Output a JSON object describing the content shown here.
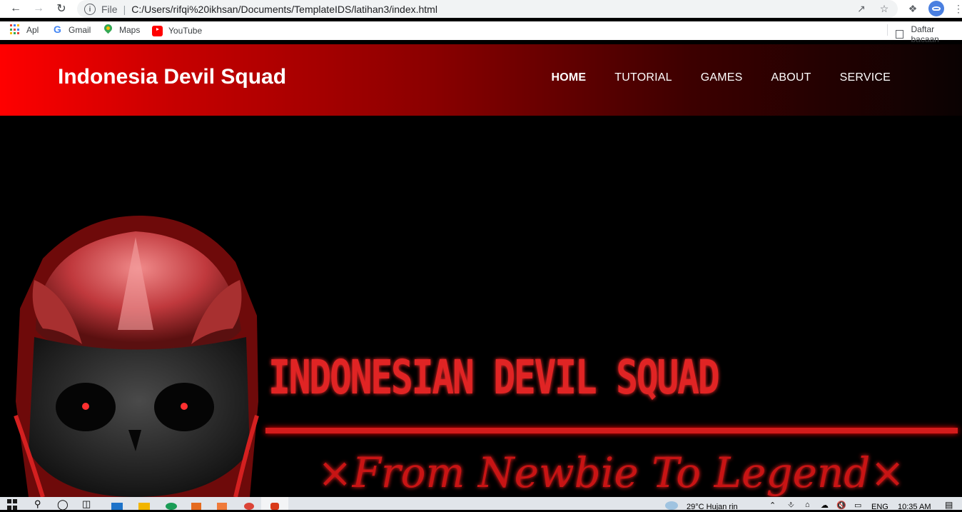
{
  "browser": {
    "scheme": "File",
    "url": "C:/Users/rifqi%20ikhsan/Documents/TemplateIDS/latihan3/index.html",
    "bookmarks": [
      "Apl",
      "Gmail",
      "Maps",
      "YouTube"
    ],
    "reading_list": "Daftar bacaan"
  },
  "site": {
    "brand": "Indonesia Devil Squad",
    "menu": [
      "HOME",
      "TUTORIAL",
      "GAMES",
      "ABOUT",
      "SERVICE"
    ],
    "active_menu": "HOME",
    "hero": {
      "title": "INDONESIAN DEVIL SQUAD",
      "tagline": "×From Newbie To Legend×"
    }
  },
  "taskbar": {
    "weather": "29°C  Hujan rin",
    "language": "ENG",
    "time": "10:35 AM"
  },
  "colors": {
    "header_start": "#ff0000",
    "header_end": "#0a0202",
    "hero_red": "#e02424"
  }
}
